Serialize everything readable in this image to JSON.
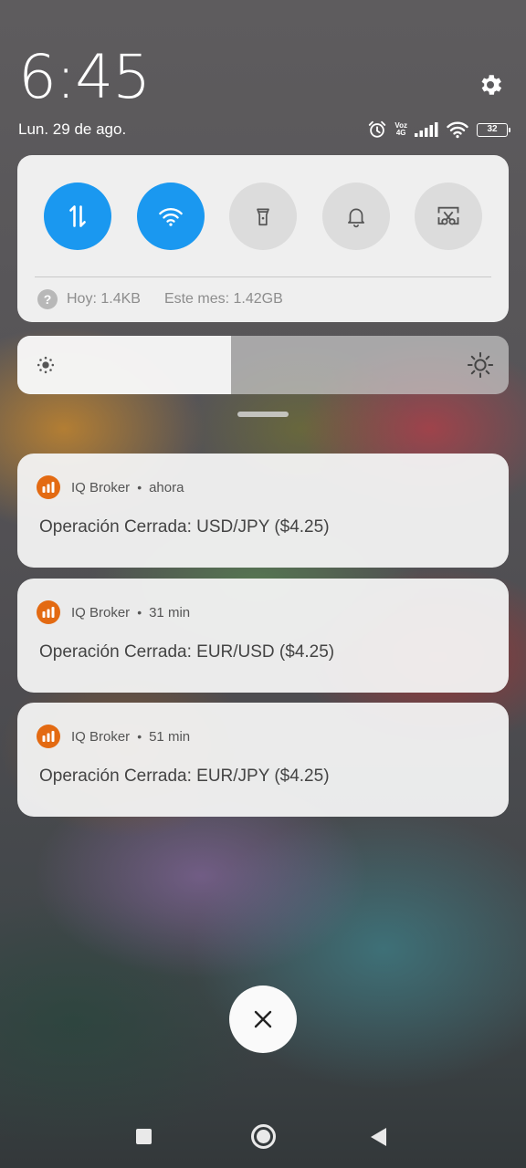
{
  "status": {
    "time": "6:45",
    "date": "Lun. 29 de ago.",
    "volte_top": "Voz",
    "volte_bottom": "4G",
    "battery": "32"
  },
  "quick_settings": {
    "toggles": [
      {
        "name": "mobile-data",
        "icon": "data-transfer-icon",
        "state": "on"
      },
      {
        "name": "wifi",
        "icon": "wifi-icon",
        "state": "on"
      },
      {
        "name": "flashlight",
        "icon": "flashlight-icon",
        "state": "off"
      },
      {
        "name": "sound",
        "icon": "bell-icon",
        "state": "off"
      },
      {
        "name": "screenshot",
        "icon": "scissors-icon",
        "state": "off"
      }
    ],
    "data_today": "Hoy: 1.4KB",
    "data_month": "Este mes: 1.42GB",
    "help_glyph": "?"
  },
  "brightness": {
    "level": 0.435
  },
  "notifications": [
    {
      "app": "IQ Broker",
      "time": "ahora",
      "text": "Operación Cerrada: USD/JPY ($4.25)"
    },
    {
      "app": "IQ Broker",
      "time": "31 min",
      "text": "Operación Cerrada: EUR/USD ($4.25)"
    },
    {
      "app": "IQ Broker",
      "time": "51 min",
      "text": "Operación Cerrada: EUR/JPY ($4.25)"
    }
  ],
  "separator": "•",
  "colors": {
    "accent": "#1a98f0",
    "app_icon": "#e36a12",
    "toggle_off": "#dcdcdc"
  },
  "icons": {
    "dismiss": "close-icon",
    "nav": [
      "recents-icon",
      "home-icon",
      "back-icon"
    ]
  }
}
